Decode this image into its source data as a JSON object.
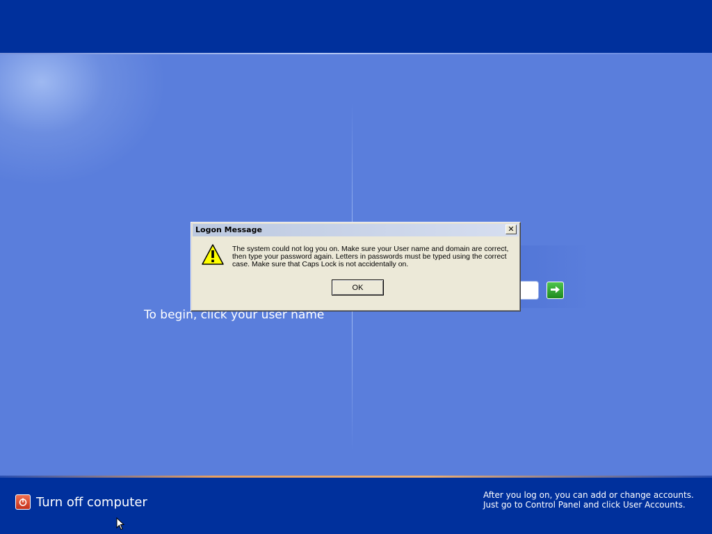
{
  "dialog": {
    "title": "Logon Message",
    "close_glyph": "✕",
    "message": "The system could not log you on. Make sure your User name and domain are correct, then type your password again.  Letters in passwords must be typed using the correct case. Make sure that Caps Lock is not accidentally on.",
    "ok_label": "OK",
    "icon": "warning-icon"
  },
  "login": {
    "instruction": "To begin, click your user name",
    "go_icon": "arrow-right-icon"
  },
  "footer": {
    "turnoff_label": "Turn off computer",
    "help_line1": "After you log on, you can add or change accounts.",
    "help_line2": "Just go to Control Panel and click User Accounts."
  },
  "colors": {
    "background": "#5a7edc",
    "bars": "#00309c",
    "dialog": "#ece9d8"
  }
}
